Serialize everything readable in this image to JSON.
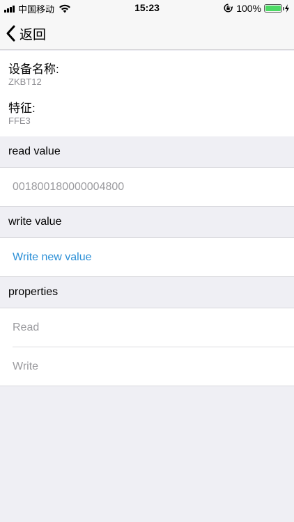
{
  "status_bar": {
    "carrier": "中国移动",
    "time": "15:23",
    "battery": "100%",
    "battery_level": 1.0,
    "battery_color": "#4cd964"
  },
  "nav": {
    "back_label": "返回",
    "back_icon": "chevron-left-icon"
  },
  "device": {
    "name_label": "设备名称:",
    "name_value": "ZKBT12",
    "characteristic_label": "特征:",
    "characteristic_value": "FFE3"
  },
  "sections": {
    "read_header": "read value",
    "read_value": "001800180000004800",
    "write_header": "write value",
    "write_action": "Write new value",
    "properties_header": "properties",
    "properties": [
      "Read",
      "Write"
    ]
  },
  "colors": {
    "background": "#efeff4",
    "link": "#2b8fd6",
    "muted_text": "#9b9b9f"
  }
}
